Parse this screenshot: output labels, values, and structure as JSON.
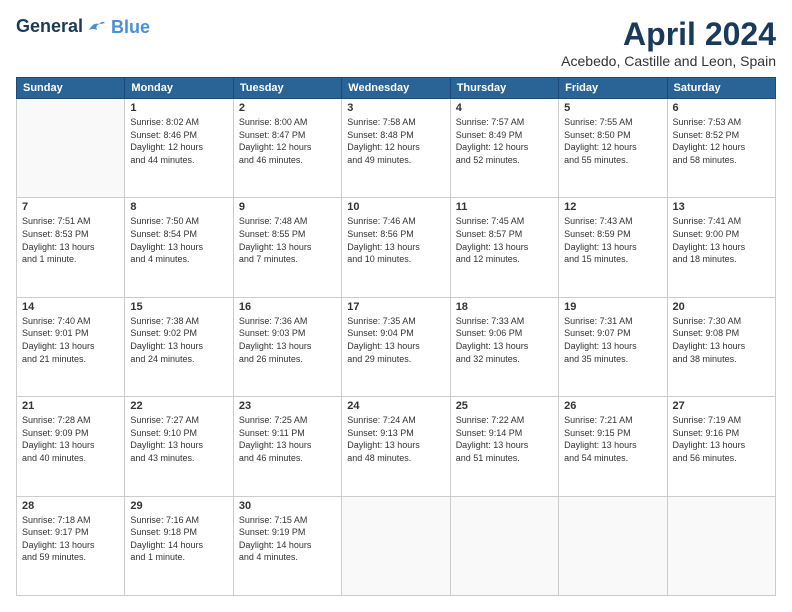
{
  "logo": {
    "line1": "General",
    "line2": "Blue"
  },
  "title": "April 2024",
  "subtitle": "Acebedo, Castille and Leon, Spain",
  "days_header": [
    "Sunday",
    "Monday",
    "Tuesday",
    "Wednesday",
    "Thursday",
    "Friday",
    "Saturday"
  ],
  "weeks": [
    [
      {
        "num": "",
        "info": ""
      },
      {
        "num": "1",
        "info": "Sunrise: 8:02 AM\nSunset: 8:46 PM\nDaylight: 12 hours\nand 44 minutes."
      },
      {
        "num": "2",
        "info": "Sunrise: 8:00 AM\nSunset: 8:47 PM\nDaylight: 12 hours\nand 46 minutes."
      },
      {
        "num": "3",
        "info": "Sunrise: 7:58 AM\nSunset: 8:48 PM\nDaylight: 12 hours\nand 49 minutes."
      },
      {
        "num": "4",
        "info": "Sunrise: 7:57 AM\nSunset: 8:49 PM\nDaylight: 12 hours\nand 52 minutes."
      },
      {
        "num": "5",
        "info": "Sunrise: 7:55 AM\nSunset: 8:50 PM\nDaylight: 12 hours\nand 55 minutes."
      },
      {
        "num": "6",
        "info": "Sunrise: 7:53 AM\nSunset: 8:52 PM\nDaylight: 12 hours\nand 58 minutes."
      }
    ],
    [
      {
        "num": "7",
        "info": "Sunrise: 7:51 AM\nSunset: 8:53 PM\nDaylight: 13 hours\nand 1 minute."
      },
      {
        "num": "8",
        "info": "Sunrise: 7:50 AM\nSunset: 8:54 PM\nDaylight: 13 hours\nand 4 minutes."
      },
      {
        "num": "9",
        "info": "Sunrise: 7:48 AM\nSunset: 8:55 PM\nDaylight: 13 hours\nand 7 minutes."
      },
      {
        "num": "10",
        "info": "Sunrise: 7:46 AM\nSunset: 8:56 PM\nDaylight: 13 hours\nand 10 minutes."
      },
      {
        "num": "11",
        "info": "Sunrise: 7:45 AM\nSunset: 8:57 PM\nDaylight: 13 hours\nand 12 minutes."
      },
      {
        "num": "12",
        "info": "Sunrise: 7:43 AM\nSunset: 8:59 PM\nDaylight: 13 hours\nand 15 minutes."
      },
      {
        "num": "13",
        "info": "Sunrise: 7:41 AM\nSunset: 9:00 PM\nDaylight: 13 hours\nand 18 minutes."
      }
    ],
    [
      {
        "num": "14",
        "info": "Sunrise: 7:40 AM\nSunset: 9:01 PM\nDaylight: 13 hours\nand 21 minutes."
      },
      {
        "num": "15",
        "info": "Sunrise: 7:38 AM\nSunset: 9:02 PM\nDaylight: 13 hours\nand 24 minutes."
      },
      {
        "num": "16",
        "info": "Sunrise: 7:36 AM\nSunset: 9:03 PM\nDaylight: 13 hours\nand 26 minutes."
      },
      {
        "num": "17",
        "info": "Sunrise: 7:35 AM\nSunset: 9:04 PM\nDaylight: 13 hours\nand 29 minutes."
      },
      {
        "num": "18",
        "info": "Sunrise: 7:33 AM\nSunset: 9:06 PM\nDaylight: 13 hours\nand 32 minutes."
      },
      {
        "num": "19",
        "info": "Sunrise: 7:31 AM\nSunset: 9:07 PM\nDaylight: 13 hours\nand 35 minutes."
      },
      {
        "num": "20",
        "info": "Sunrise: 7:30 AM\nSunset: 9:08 PM\nDaylight: 13 hours\nand 38 minutes."
      }
    ],
    [
      {
        "num": "21",
        "info": "Sunrise: 7:28 AM\nSunset: 9:09 PM\nDaylight: 13 hours\nand 40 minutes."
      },
      {
        "num": "22",
        "info": "Sunrise: 7:27 AM\nSunset: 9:10 PM\nDaylight: 13 hours\nand 43 minutes."
      },
      {
        "num": "23",
        "info": "Sunrise: 7:25 AM\nSunset: 9:11 PM\nDaylight: 13 hours\nand 46 minutes."
      },
      {
        "num": "24",
        "info": "Sunrise: 7:24 AM\nSunset: 9:13 PM\nDaylight: 13 hours\nand 48 minutes."
      },
      {
        "num": "25",
        "info": "Sunrise: 7:22 AM\nSunset: 9:14 PM\nDaylight: 13 hours\nand 51 minutes."
      },
      {
        "num": "26",
        "info": "Sunrise: 7:21 AM\nSunset: 9:15 PM\nDaylight: 13 hours\nand 54 minutes."
      },
      {
        "num": "27",
        "info": "Sunrise: 7:19 AM\nSunset: 9:16 PM\nDaylight: 13 hours\nand 56 minutes."
      }
    ],
    [
      {
        "num": "28",
        "info": "Sunrise: 7:18 AM\nSunset: 9:17 PM\nDaylight: 13 hours\nand 59 minutes."
      },
      {
        "num": "29",
        "info": "Sunrise: 7:16 AM\nSunset: 9:18 PM\nDaylight: 14 hours\nand 1 minute."
      },
      {
        "num": "30",
        "info": "Sunrise: 7:15 AM\nSunset: 9:19 PM\nDaylight: 14 hours\nand 4 minutes."
      },
      {
        "num": "",
        "info": ""
      },
      {
        "num": "",
        "info": ""
      },
      {
        "num": "",
        "info": ""
      },
      {
        "num": "",
        "info": ""
      }
    ]
  ]
}
